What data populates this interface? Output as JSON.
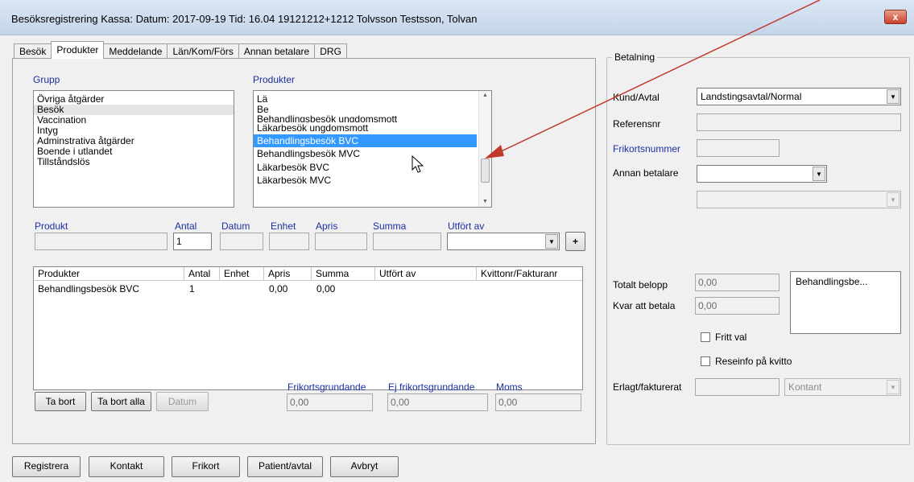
{
  "window": {
    "title": "Besöksregistrering Kassa:   Datum: 2017-09-19  Tid: 16.04  19121212+1212 Tolvsson Testsson, Tolvan",
    "close_label": "x"
  },
  "tabs": [
    "Besök",
    "Produkter",
    "Meddelande",
    "Län/Kom/Förs",
    "Annan betalare",
    "DRG"
  ],
  "grupp": {
    "label": "Grupp",
    "items": [
      "Övriga åtgärder",
      "Besök",
      "Vaccination",
      "Intyg",
      "Adminstrativa åtgärder",
      "Boende i utlandet",
      "Tillståndslös"
    ],
    "highlighted_index": 1
  },
  "produkter_list": {
    "label": "Produkter",
    "items": [
      "Lä",
      "Be",
      "Behandlingsbesök ungdomsmott",
      "Läkarbesök ungdomsmott",
      "Behandlingsbesök BVC",
      "Behandlingsbesök MVC",
      "Läkarbesök BVC",
      "Läkarbesök MVC"
    ],
    "selected_index": 4
  },
  "entry": {
    "produkt_label": "Produkt",
    "antal_label": "Antal",
    "antal_value": "1",
    "datum_label": "Datum",
    "enhet_label": "Enhet",
    "apris_label": "Apris",
    "summa_label": "Summa",
    "utfort_label": "Utfört av",
    "add_label": "+"
  },
  "table": {
    "columns": [
      "Produkter",
      "Antal",
      "Enhet",
      "Apris",
      "Summa",
      "Utfört av",
      "Kvittonr/Fakturanr"
    ],
    "rows": [
      {
        "produkt": "Behandlingsbesök BVC",
        "antal": "1",
        "enhet": "",
        "apris": "0,00",
        "summa": "0,00",
        "utfort": "",
        "kvitto": ""
      }
    ]
  },
  "totals": {
    "frikort_label": "Frikortsgrundande",
    "frikort_value": "0,00",
    "ej_frikort_label": "Ej frikortsgrundande",
    "ej_frikort_value": "0,00",
    "moms_label": "Moms",
    "moms_value": "0,00"
  },
  "row_buttons": {
    "ta_bort": "Ta bort",
    "ta_bort_alla": "Ta bort alla",
    "datum": "Datum"
  },
  "betalning": {
    "title": "Betalning",
    "kund_label": "Kund/Avtal",
    "kund_value": "Landstingsavtal/Normal",
    "referens_label": "Referensnr",
    "frikortsnummer_label": "Frikortsnummer",
    "annan_label": "Annan betalare",
    "totalt_label": "Totalt belopp",
    "totalt_value": "0,00",
    "kvar_label": "Kvar att betala",
    "kvar_value": "0,00",
    "memo_text": "Behandlingsbe...",
    "fritt_val_label": "Fritt val",
    "reseinfo_label": "Reseinfo på kvitto",
    "erlagt_label": "Erlagt/fakturerat",
    "kontant_value": "Kontant"
  },
  "bottom_buttons": [
    "Registrera",
    "Kontakt",
    "Frikort",
    "Patient/avtal",
    "Avbryt"
  ],
  "colors": {
    "selection": "#3399ff",
    "label_blue": "#1b2fa0",
    "annotation_arrow": "#c0392b"
  }
}
